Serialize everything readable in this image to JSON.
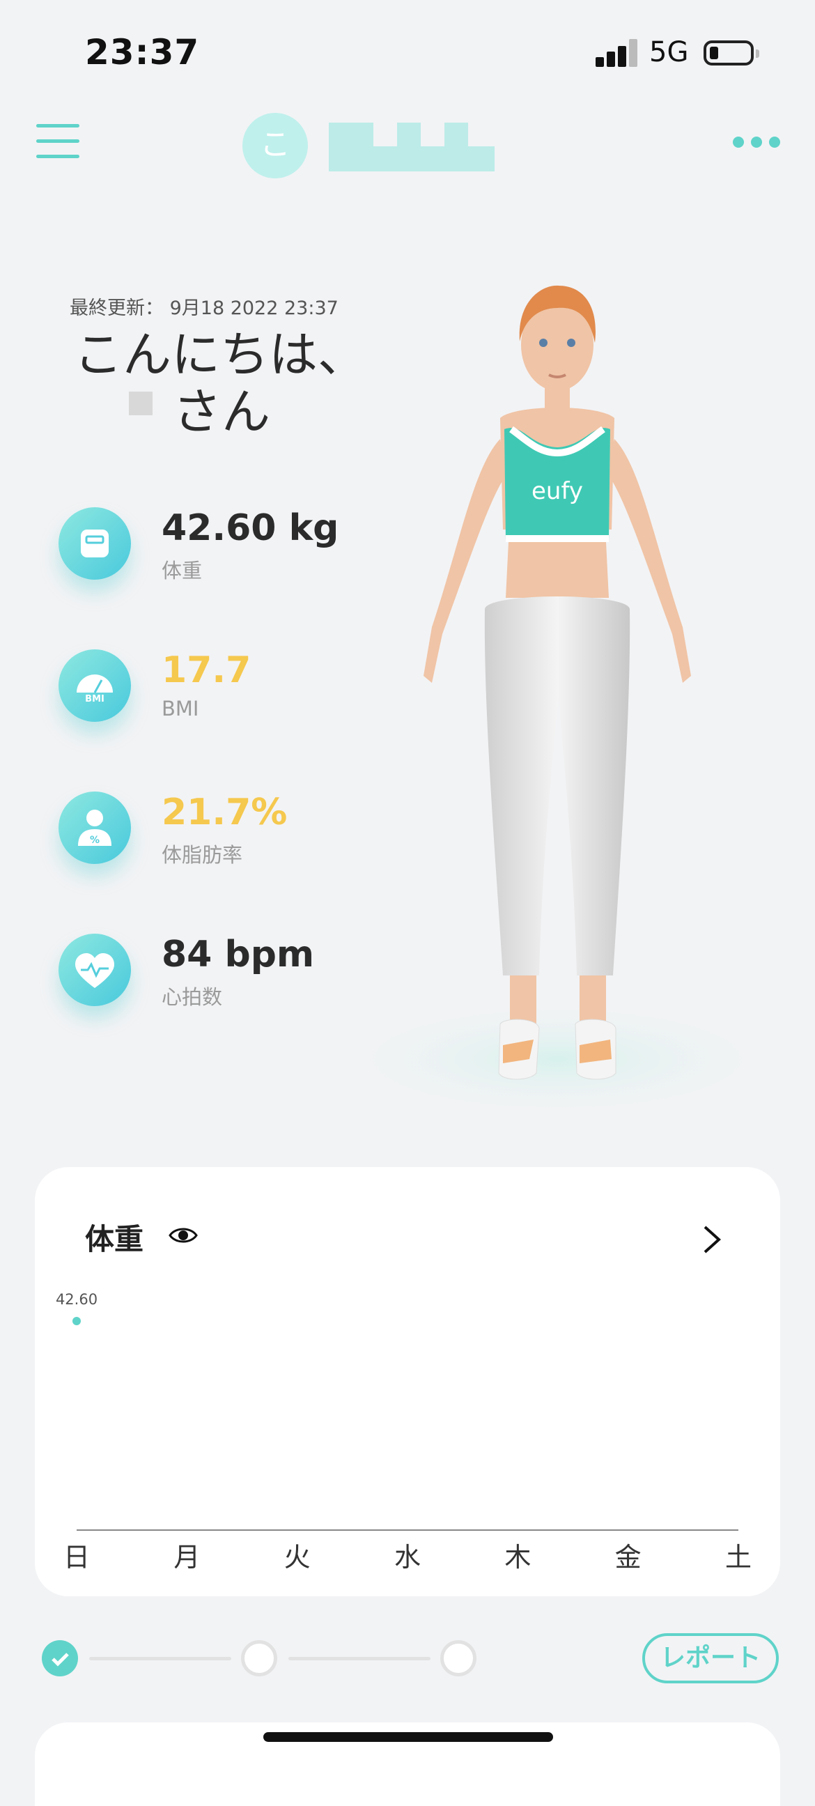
{
  "status_bar": {
    "time": "23:37",
    "network": "5G",
    "battery_level": 0.15
  },
  "header": {
    "avatar_initial": "こ"
  },
  "greeting": {
    "last_updated": "最終更新： 9月18 2022 23:37",
    "hello": "こんにちは、",
    "suffix": "さん"
  },
  "metrics": [
    {
      "value": "42.60 kg",
      "label": "体重",
      "icon": "scale-icon",
      "status": "normal"
    },
    {
      "value": "17.7",
      "label": "BMI",
      "icon": "bmi-gauge-icon",
      "icon_text": "BMI",
      "status": "warning"
    },
    {
      "value": "21.7%",
      "label": "体脂肪率",
      "icon": "body-fat-icon",
      "status": "warning"
    },
    {
      "value": "84 bpm",
      "label": "心拍数",
      "icon": "heart-rate-icon",
      "status": "normal"
    }
  ],
  "avatar_figure": {
    "top_logo": "eufy"
  },
  "card": {
    "title": "体重",
    "icons": [
      "eye-icon",
      "chevron-right-icon"
    ]
  },
  "chart_data": {
    "type": "line",
    "categories": [
      "日",
      "月",
      "火",
      "水",
      "木",
      "金",
      "土"
    ],
    "series": [
      {
        "values": [
          42.6,
          null,
          null,
          null,
          null,
          null,
          null
        ]
      }
    ],
    "data_labels": [
      "42.60"
    ]
  },
  "progress": {
    "steps": [
      {
        "done": true
      },
      {
        "done": false
      },
      {
        "done": false
      }
    ],
    "report_label": "レポート"
  },
  "colors": {
    "accent": "#5fd3c9",
    "warning": "#f5c84e",
    "background": "#f2f3f5"
  }
}
